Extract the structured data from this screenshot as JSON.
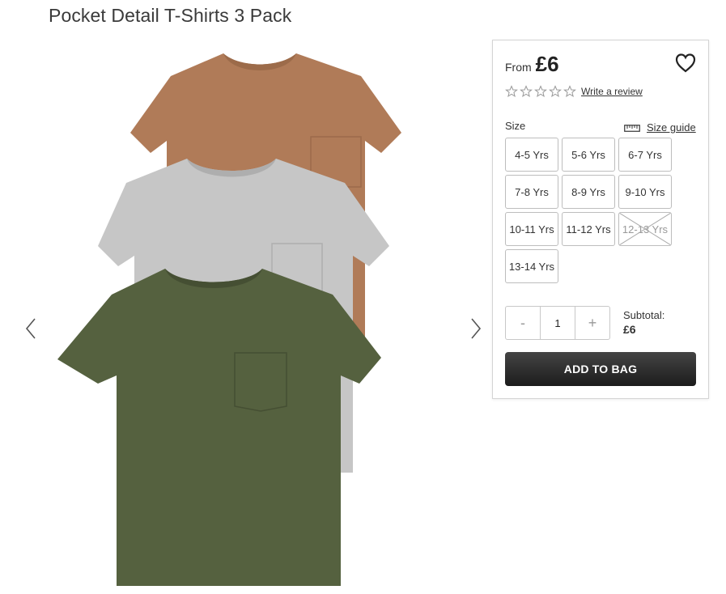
{
  "product": {
    "title": "Pocket Detail T-Shirts 3 Pack",
    "image_icon": "tshirt-pack-image",
    "colors": {
      "brown": "#b07b58",
      "grey": "#c6c6c6",
      "khaki": "#55613f"
    }
  },
  "price": {
    "from_label": "From",
    "value": "£6"
  },
  "rating": {
    "stars": 0,
    "max": 5,
    "write_review_label": "Write a review"
  },
  "size": {
    "label": "Size",
    "guide_label": "Size guide",
    "options": [
      {
        "label": "4-5 Yrs",
        "available": true
      },
      {
        "label": "5-6 Yrs",
        "available": true
      },
      {
        "label": "6-7 Yrs",
        "available": true
      },
      {
        "label": "7-8 Yrs",
        "available": true
      },
      {
        "label": "8-9 Yrs",
        "available": true
      },
      {
        "label": "9-10 Yrs",
        "available": true
      },
      {
        "label": "10-11 Yrs",
        "available": true
      },
      {
        "label": "11-12 Yrs",
        "available": true
      },
      {
        "label": "12-13 Yrs",
        "available": false
      },
      {
        "label": "13-14 Yrs",
        "available": true
      }
    ]
  },
  "quantity": {
    "decrement_label": "-",
    "value": "1",
    "increment_label": "+"
  },
  "subtotal": {
    "label": "Subtotal:",
    "value": "£6"
  },
  "add_to_bag_label": "ADD TO BAG"
}
